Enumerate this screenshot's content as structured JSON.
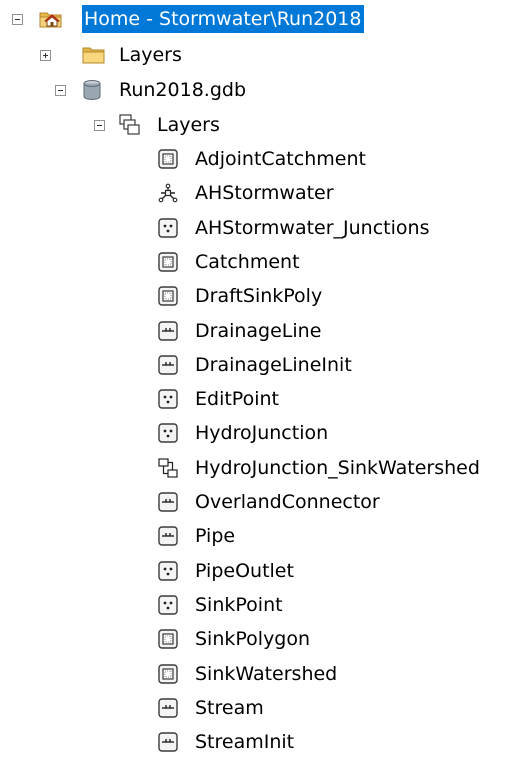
{
  "root": {
    "label": "Home - Stormwater\\Run2018",
    "icon": "home-folder-icon",
    "expanded": true,
    "selected_color": "#0078d7"
  },
  "layers_folder": {
    "label": "Layers",
    "icon": "folder-icon",
    "expanded": false
  },
  "gdb": {
    "label": "Run2018.gdb",
    "icon": "geodatabase-icon",
    "expanded": true
  },
  "dataset": {
    "label": "Layers",
    "icon": "feature-dataset-icon",
    "expanded": true
  },
  "items": [
    {
      "label": "AdjointCatchment",
      "icon": "polygon-feature-class-icon"
    },
    {
      "label": "AHStormwater",
      "icon": "geometric-network-icon"
    },
    {
      "label": "AHStormwater_Junctions",
      "icon": "point-feature-class-icon"
    },
    {
      "label": "Catchment",
      "icon": "polygon-feature-class-icon"
    },
    {
      "label": "DraftSinkPoly",
      "icon": "polygon-feature-class-icon"
    },
    {
      "label": "DrainageLine",
      "icon": "line-feature-class-icon"
    },
    {
      "label": "DrainageLineInit",
      "icon": "line-feature-class-icon"
    },
    {
      "label": "EditPoint",
      "icon": "point-feature-class-icon"
    },
    {
      "label": "HydroJunction",
      "icon": "point-feature-class-icon"
    },
    {
      "label": "HydroJunction_SinkWatershed",
      "icon": "relationship-class-icon"
    },
    {
      "label": "OverlandConnector",
      "icon": "line-feature-class-icon"
    },
    {
      "label": "Pipe",
      "icon": "line-feature-class-icon"
    },
    {
      "label": "PipeOutlet",
      "icon": "point-feature-class-icon"
    },
    {
      "label": "SinkPoint",
      "icon": "point-feature-class-icon"
    },
    {
      "label": "SinkPolygon",
      "icon": "polygon-feature-class-icon"
    },
    {
      "label": "SinkWatershed",
      "icon": "polygon-feature-class-icon"
    },
    {
      "label": "Stream",
      "icon": "line-feature-class-icon"
    },
    {
      "label": "StreamInit",
      "icon": "line-feature-class-icon"
    }
  ]
}
